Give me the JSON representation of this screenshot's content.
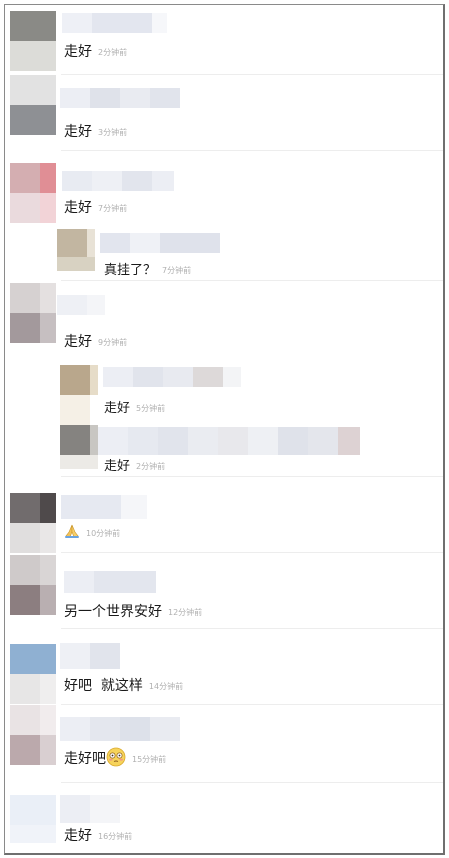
{
  "comments": [
    {
      "text": "走好",
      "time": "2分钟前"
    },
    {
      "text": "走好",
      "time": "3分钟前"
    },
    {
      "text": "走好",
      "time": "7分钟前",
      "reply": {
        "text": "真挂了？",
        "time": "7分钟前"
      }
    },
    {
      "text": "走好",
      "time": "9分钟前",
      "replies": [
        {
          "text": "走好",
          "time": "5分钟前"
        },
        {
          "text": "走好",
          "time": "2分钟前"
        }
      ]
    },
    {
      "text": "",
      "emoji": "folded-hands-icon",
      "time": "10分钟前"
    },
    {
      "text": "另一个世界安好",
      "time": "12分钟前"
    },
    {
      "text": "好吧  就这样",
      "time": "14分钟前"
    },
    {
      "text": "走好吧",
      "emoji": "flushed-face-icon",
      "time": "15分钟前"
    },
    {
      "text": "走好",
      "time": "16分钟前"
    }
  ],
  "colors": {
    "text": "#1a1a1a",
    "time": "#b0b0b0",
    "divider": "#ededed",
    "frame_border": "#8a8a8a"
  }
}
